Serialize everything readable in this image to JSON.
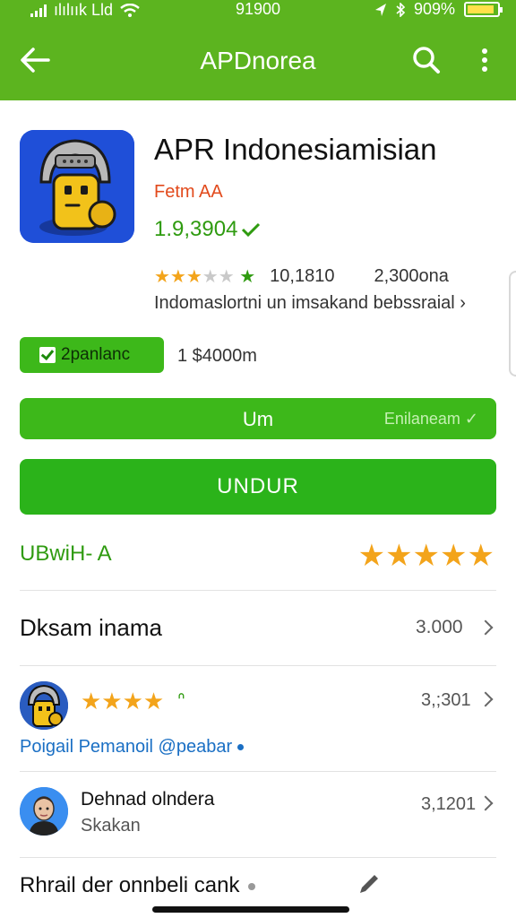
{
  "status_bar": {
    "carrier": "ılılıık Lld",
    "time": "91900",
    "battery": "909%",
    "battery_level": 0.9
  },
  "header": {
    "title": "APDnorea"
  },
  "app": {
    "name": "APR Indonesiamisian",
    "developer": "Fetm AA",
    "version": "1.9,3904",
    "rating_stars": 4,
    "rating_count": "10,1810",
    "downloads": "2,300ona",
    "description": "Indomaslortni un imsakand bebssraial",
    "badge": "2panlanc",
    "size": "1 $4000m"
  },
  "buttons": {
    "secondary_label": "Um",
    "secondary_extra": "Enilaneam",
    "primary_label": "UNDUR"
  },
  "rating_section": {
    "label": "UBwiH- A",
    "stars": 5
  },
  "reviews_section": {
    "title": "Dksam inama",
    "count": "3.000"
  },
  "reviews": [
    {
      "stars": "★★★★",
      "thumb": "ᐢ",
      "count": "3,;301",
      "user": "Poigail  Pemanoil @peabar"
    },
    {
      "name": "Dehnad olndera",
      "subtitle": "Skakan",
      "count": "3,1201"
    }
  ],
  "footer_row": {
    "text": "Rhrail der onnbeli  cank"
  },
  "colors": {
    "header_green": "#5cb41f",
    "button_green": "#3db81a",
    "primary_green": "#2bb31a",
    "star": "#f3a41b",
    "developer": "#e24a1c",
    "link_blue": "#1a6fc4"
  },
  "icons": [
    "back-arrow-icon",
    "search-icon",
    "more-vert-icon",
    "check-icon",
    "chevron-right-icon",
    "edit-pencil-icon"
  ]
}
